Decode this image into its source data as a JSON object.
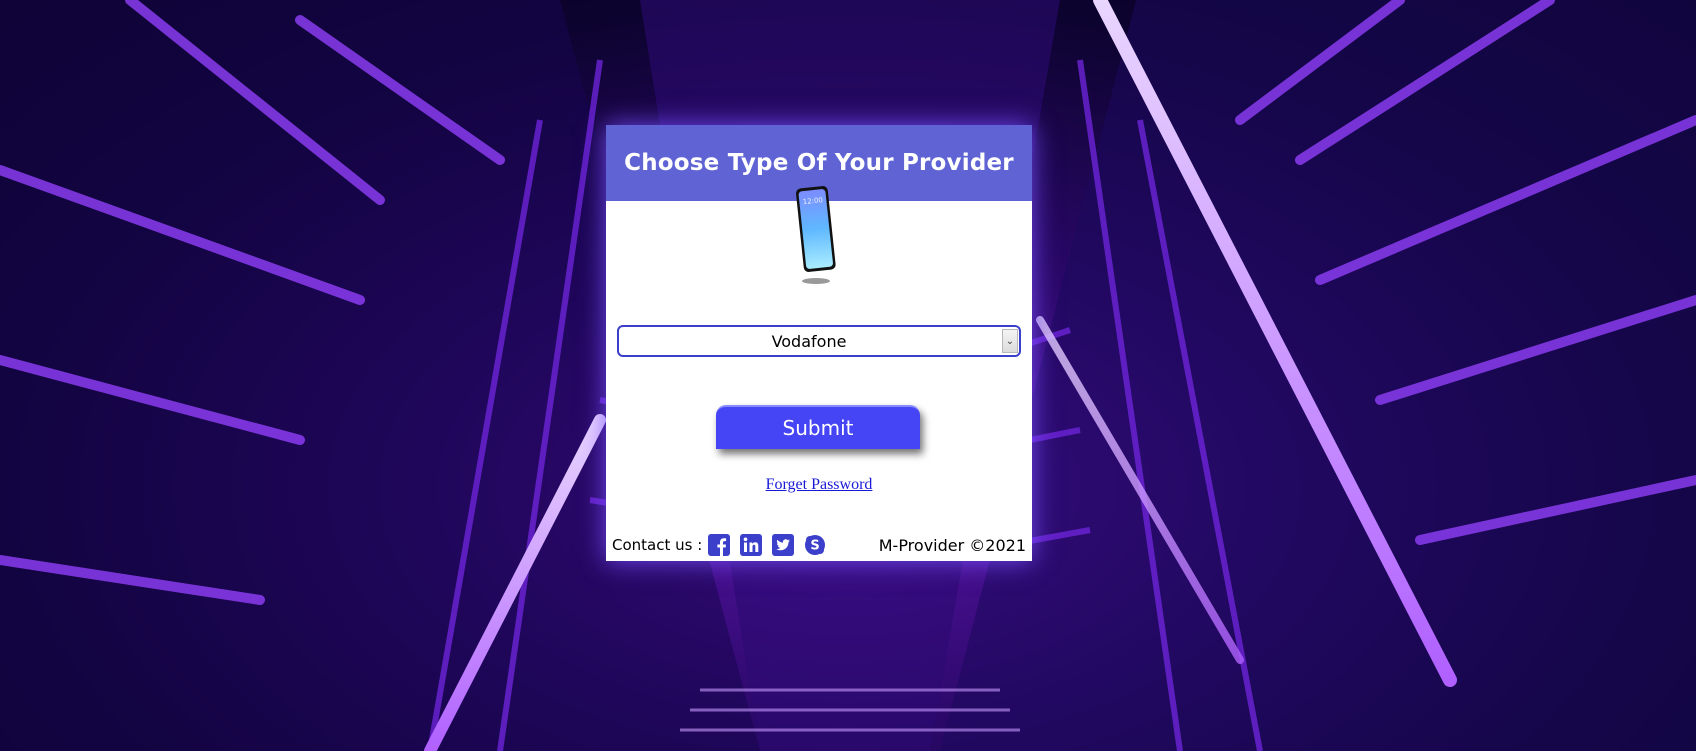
{
  "card": {
    "title": "Choose Type Of Your Provider",
    "provider_select": {
      "selected": "Vodafone"
    },
    "submit_label": "Submit",
    "forget_password_label": "Forget Password"
  },
  "footer": {
    "contact_label": "Contact us :",
    "social_icons": [
      "facebook-icon",
      "linkedin-icon",
      "twitter-icon",
      "skype-icon"
    ],
    "copyright": "M-Provider ©2021"
  },
  "phone_screen_text": "12:00",
  "colors": {
    "header": "#5f63d3",
    "submit": "#4545f5",
    "icons": "#3b3fc9",
    "link": "#1a1ad6"
  }
}
